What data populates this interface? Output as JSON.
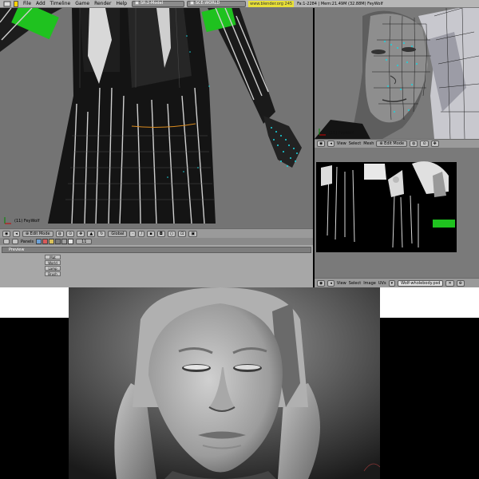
{
  "topbar": {
    "menus": [
      "File",
      "Add",
      "Timeline",
      "Game",
      "Render",
      "Help"
    ],
    "screen": "SR:2-Model",
    "scene": "SCE:WORLD",
    "url": "www.blender.org 245",
    "stats": "Fa:1-2284 | Mem:21.49M (32.88M) FeyWolf"
  },
  "viewport_left": {
    "object_label": "(11) FeyWolf",
    "mode": "Edit Mode",
    "orientation": "Global",
    "layer_value": "11"
  },
  "panel_header": {
    "label": "Panels"
  },
  "preview": {
    "title": "Preview",
    "buttons": [
      "Mat",
      "World",
      "Lamp",
      "Brush"
    ]
  },
  "viewport_tr": {
    "object_label": "(11) FeyWolf",
    "menus": [
      "View",
      "Select",
      "Mesh"
    ],
    "mode": "Edit Mode"
  },
  "image_editor": {
    "menus": [
      "View",
      "Select",
      "Image",
      "UVs"
    ],
    "image_name": "Wolf-wholebody.psd"
  },
  "colors": {
    "accent_green": "#1fc21f",
    "edit_cyan": "#19d6e0",
    "url_yellow": "#e8e038"
  }
}
